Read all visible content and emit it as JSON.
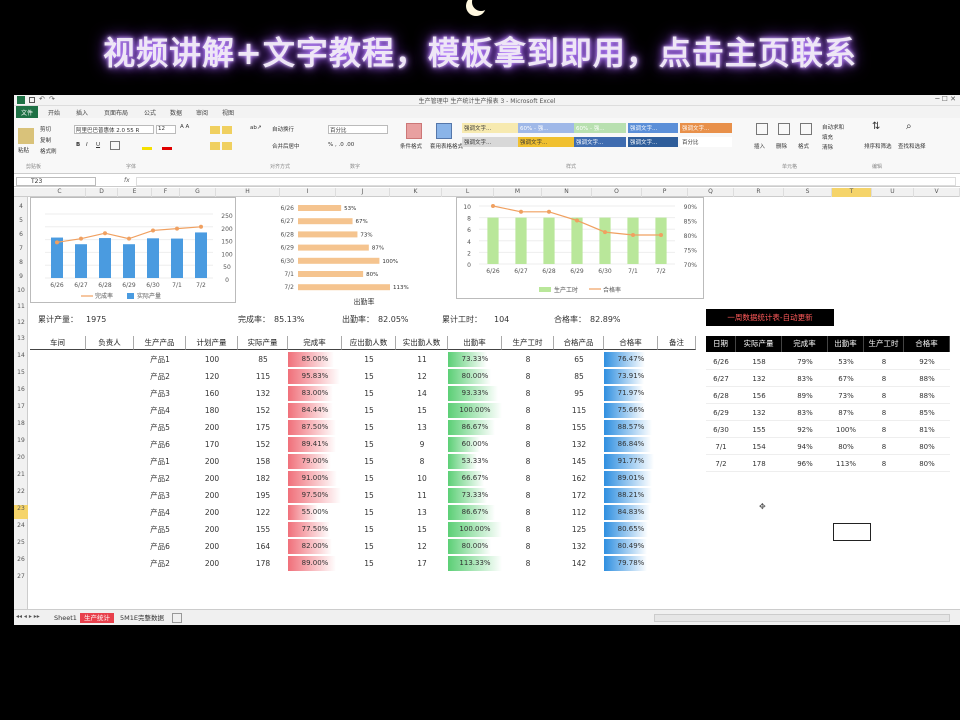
{
  "banner": {
    "text": "视频讲解+文字教程，模板拿到即用，点击主页联系"
  },
  "window": {
    "title": "生产管理中 生产统计生产报表 3 - Microsoft Excel"
  },
  "tabs": [
    "文件",
    "开始",
    "插入",
    "页面布局",
    "公式",
    "数据",
    "审阅",
    "视图"
  ],
  "ribbon": {
    "clipboard": [
      "剪切",
      "复制",
      "格式刷"
    ],
    "paste": "粘贴",
    "font_name": "阿里巴巴普惠体 2.0 55 R",
    "font_size": "12",
    "wrap": "自动换行",
    "merge": "合并后居中",
    "number_format": "百分比",
    "cond_format": "条件格式",
    "table_format": "套用表格格式",
    "styles": [
      "强调文字...",
      "60% - 强...",
      "60% - 强...",
      "强调文字...",
      "强调文字...",
      "强调文字...",
      "强调文字...",
      "强调文字...",
      "强调文字...",
      "百分比"
    ],
    "insert": "插入",
    "delete": "删除",
    "format": "格式",
    "autosum": "自动求和",
    "fill": "填充",
    "clear": "清除",
    "sort": "排序和筛选",
    "find": "查找和选择",
    "groups": [
      "剪贴板",
      "字体",
      "对齐方式",
      "数字",
      "样式",
      "单元格",
      "编辑"
    ]
  },
  "formula_bar": {
    "name_box": "T23",
    "fx": "fx"
  },
  "columns": [
    "C",
    "D",
    "E",
    "F",
    "G",
    "H",
    "I",
    "J",
    "K",
    "L",
    "M",
    "N",
    "O",
    "P",
    "Q",
    "R",
    "S",
    "T",
    "U",
    "V"
  ],
  "rows": [
    "4",
    "5",
    "6",
    "7",
    "8",
    "9",
    "10",
    "11",
    "12",
    "13",
    "14",
    "15",
    "16",
    "17",
    "18",
    "19",
    "20",
    "21",
    "22",
    "23",
    "24",
    "25",
    "26",
    "27"
  ],
  "chart1": {
    "categories": [
      "6/26",
      "6/27",
      "6/28",
      "6/29",
      "6/30",
      "7/1",
      "7/2"
    ],
    "bars": [
      158,
      132,
      156,
      132,
      155,
      154,
      178
    ],
    "line": [
      79,
      83,
      89,
      83,
      92,
      94,
      96
    ],
    "y_ticks": [
      "250",
      "200",
      "150",
      "100",
      "50",
      "0"
    ],
    "legend": [
      "完成率",
      "实际产量"
    ]
  },
  "chart2": {
    "categories": [
      "6/26",
      "6/27",
      "6/28",
      "6/29",
      "6/30",
      "7/1",
      "7/2"
    ],
    "values": [
      53,
      67,
      73,
      87,
      100,
      80,
      113
    ],
    "labels": [
      "53%",
      "67%",
      "73%",
      "87%",
      "100%",
      "80%",
      "113%"
    ],
    "title": "出勤率"
  },
  "chart3": {
    "categories": [
      "6/26",
      "6/27",
      "6/28",
      "6/29",
      "6/30",
      "7/1",
      "7/2"
    ],
    "bars": [
      8,
      8,
      8,
      8,
      8,
      8,
      8
    ],
    "line": [
      90,
      88,
      88,
      85,
      81,
      80,
      80
    ],
    "y_left": [
      "10",
      "8",
      "6",
      "4",
      "2",
      "0"
    ],
    "y_right": [
      "90%",
      "85%",
      "80%",
      "75%",
      "70%"
    ],
    "legend": [
      "生产工时",
      "合格率"
    ]
  },
  "summary": {
    "total_label": "累计产量：",
    "total": "1975",
    "rate_label": "完成率：",
    "rate": "85.13%",
    "attend_label": "出勤率：",
    "attend": "82.05%",
    "hours_label": "累计工时：",
    "hours": "104",
    "pass_label": "合格率：",
    "pass": "82.89%"
  },
  "table": {
    "headers": [
      "车间",
      "负责人",
      "生产产品",
      "计划产量",
      "实际产量",
      "完成率",
      "应出勤人数",
      "实出勤人数",
      "出勤率",
      "生产工时",
      "合格产品",
      "合格率",
      "备注"
    ],
    "rows": [
      [
        "产品1",
        "100",
        "85",
        "85.00%",
        "15",
        "11",
        "73.33%",
        "8",
        "65",
        "76.47%",
        0.85,
        0.73,
        0.76
      ],
      [
        "产品2",
        "120",
        "115",
        "95.83%",
        "15",
        "12",
        "80.00%",
        "8",
        "85",
        "73.91%",
        0.96,
        0.8,
        0.74
      ],
      [
        "产品3",
        "160",
        "132",
        "83.00%",
        "15",
        "14",
        "93.33%",
        "8",
        "95",
        "71.97%",
        0.83,
        0.93,
        0.72
      ],
      [
        "产品4",
        "180",
        "152",
        "84.44%",
        "15",
        "15",
        "100.00%",
        "8",
        "115",
        "75.66%",
        0.84,
        1,
        0.76
      ],
      [
        "产品5",
        "200",
        "175",
        "87.50%",
        "15",
        "13",
        "86.67%",
        "8",
        "155",
        "88.57%",
        0.88,
        0.87,
        0.89
      ],
      [
        "产品6",
        "170",
        "152",
        "89.41%",
        "15",
        "9",
        "60.00%",
        "8",
        "132",
        "86.84%",
        0.89,
        0.6,
        0.87
      ],
      [
        "产品1",
        "200",
        "158",
        "79.00%",
        "15",
        "8",
        "53.33%",
        "8",
        "145",
        "91.77%",
        0.79,
        0.53,
        0.92
      ],
      [
        "产品2",
        "200",
        "182",
        "91.00%",
        "15",
        "10",
        "66.67%",
        "8",
        "162",
        "89.01%",
        0.91,
        0.67,
        0.89
      ],
      [
        "产品3",
        "200",
        "195",
        "97.50%",
        "15",
        "11",
        "73.33%",
        "8",
        "172",
        "88.21%",
        0.98,
        0.73,
        0.88
      ],
      [
        "产品4",
        "200",
        "122",
        "55.00%",
        "15",
        "13",
        "86.67%",
        "8",
        "112",
        "84.83%",
        0.55,
        0.87,
        0.85
      ],
      [
        "产品5",
        "200",
        "155",
        "77.50%",
        "15",
        "15",
        "100.00%",
        "8",
        "125",
        "80.65%",
        0.78,
        1,
        0.81
      ],
      [
        "产品6",
        "200",
        "164",
        "82.00%",
        "15",
        "12",
        "80.00%",
        "8",
        "132",
        "80.49%",
        0.82,
        0.8,
        0.8
      ],
      [
        "产品2",
        "200",
        "178",
        "89.00%",
        "15",
        "17",
        "113.33%",
        "8",
        "142",
        "79.78%",
        0.89,
        1,
        0.8
      ]
    ]
  },
  "right_panel": {
    "title": "一周数据统计表-自动更新",
    "headers": [
      "日期",
      "实际产量",
      "完成率",
      "出勤率",
      "生产工时",
      "合格率"
    ],
    "rows": [
      [
        "6/26",
        "158",
        "79%",
        "53%",
        "8",
        "92%"
      ],
      [
        "6/27",
        "132",
        "83%",
        "67%",
        "8",
        "88%"
      ],
      [
        "6/28",
        "156",
        "89%",
        "73%",
        "8",
        "88%"
      ],
      [
        "6/29",
        "132",
        "83%",
        "87%",
        "8",
        "85%"
      ],
      [
        "6/30",
        "155",
        "92%",
        "100%",
        "8",
        "81%"
      ],
      [
        "7/1",
        "154",
        "94%",
        "80%",
        "8",
        "80%"
      ],
      [
        "7/2",
        "178",
        "96%",
        "113%",
        "8",
        "80%"
      ]
    ]
  },
  "sheets": [
    "Sheet1",
    "生产统计",
    "5M1E完整数据"
  ],
  "colors": {
    "excel_green": "#1e7145",
    "red_bar": "#f0707a",
    "green_bar": "#5ccf76",
    "blue_bar": "#2f8fe0",
    "chart_blue": "#4a9be0",
    "chart_orange": "#f0a060"
  }
}
